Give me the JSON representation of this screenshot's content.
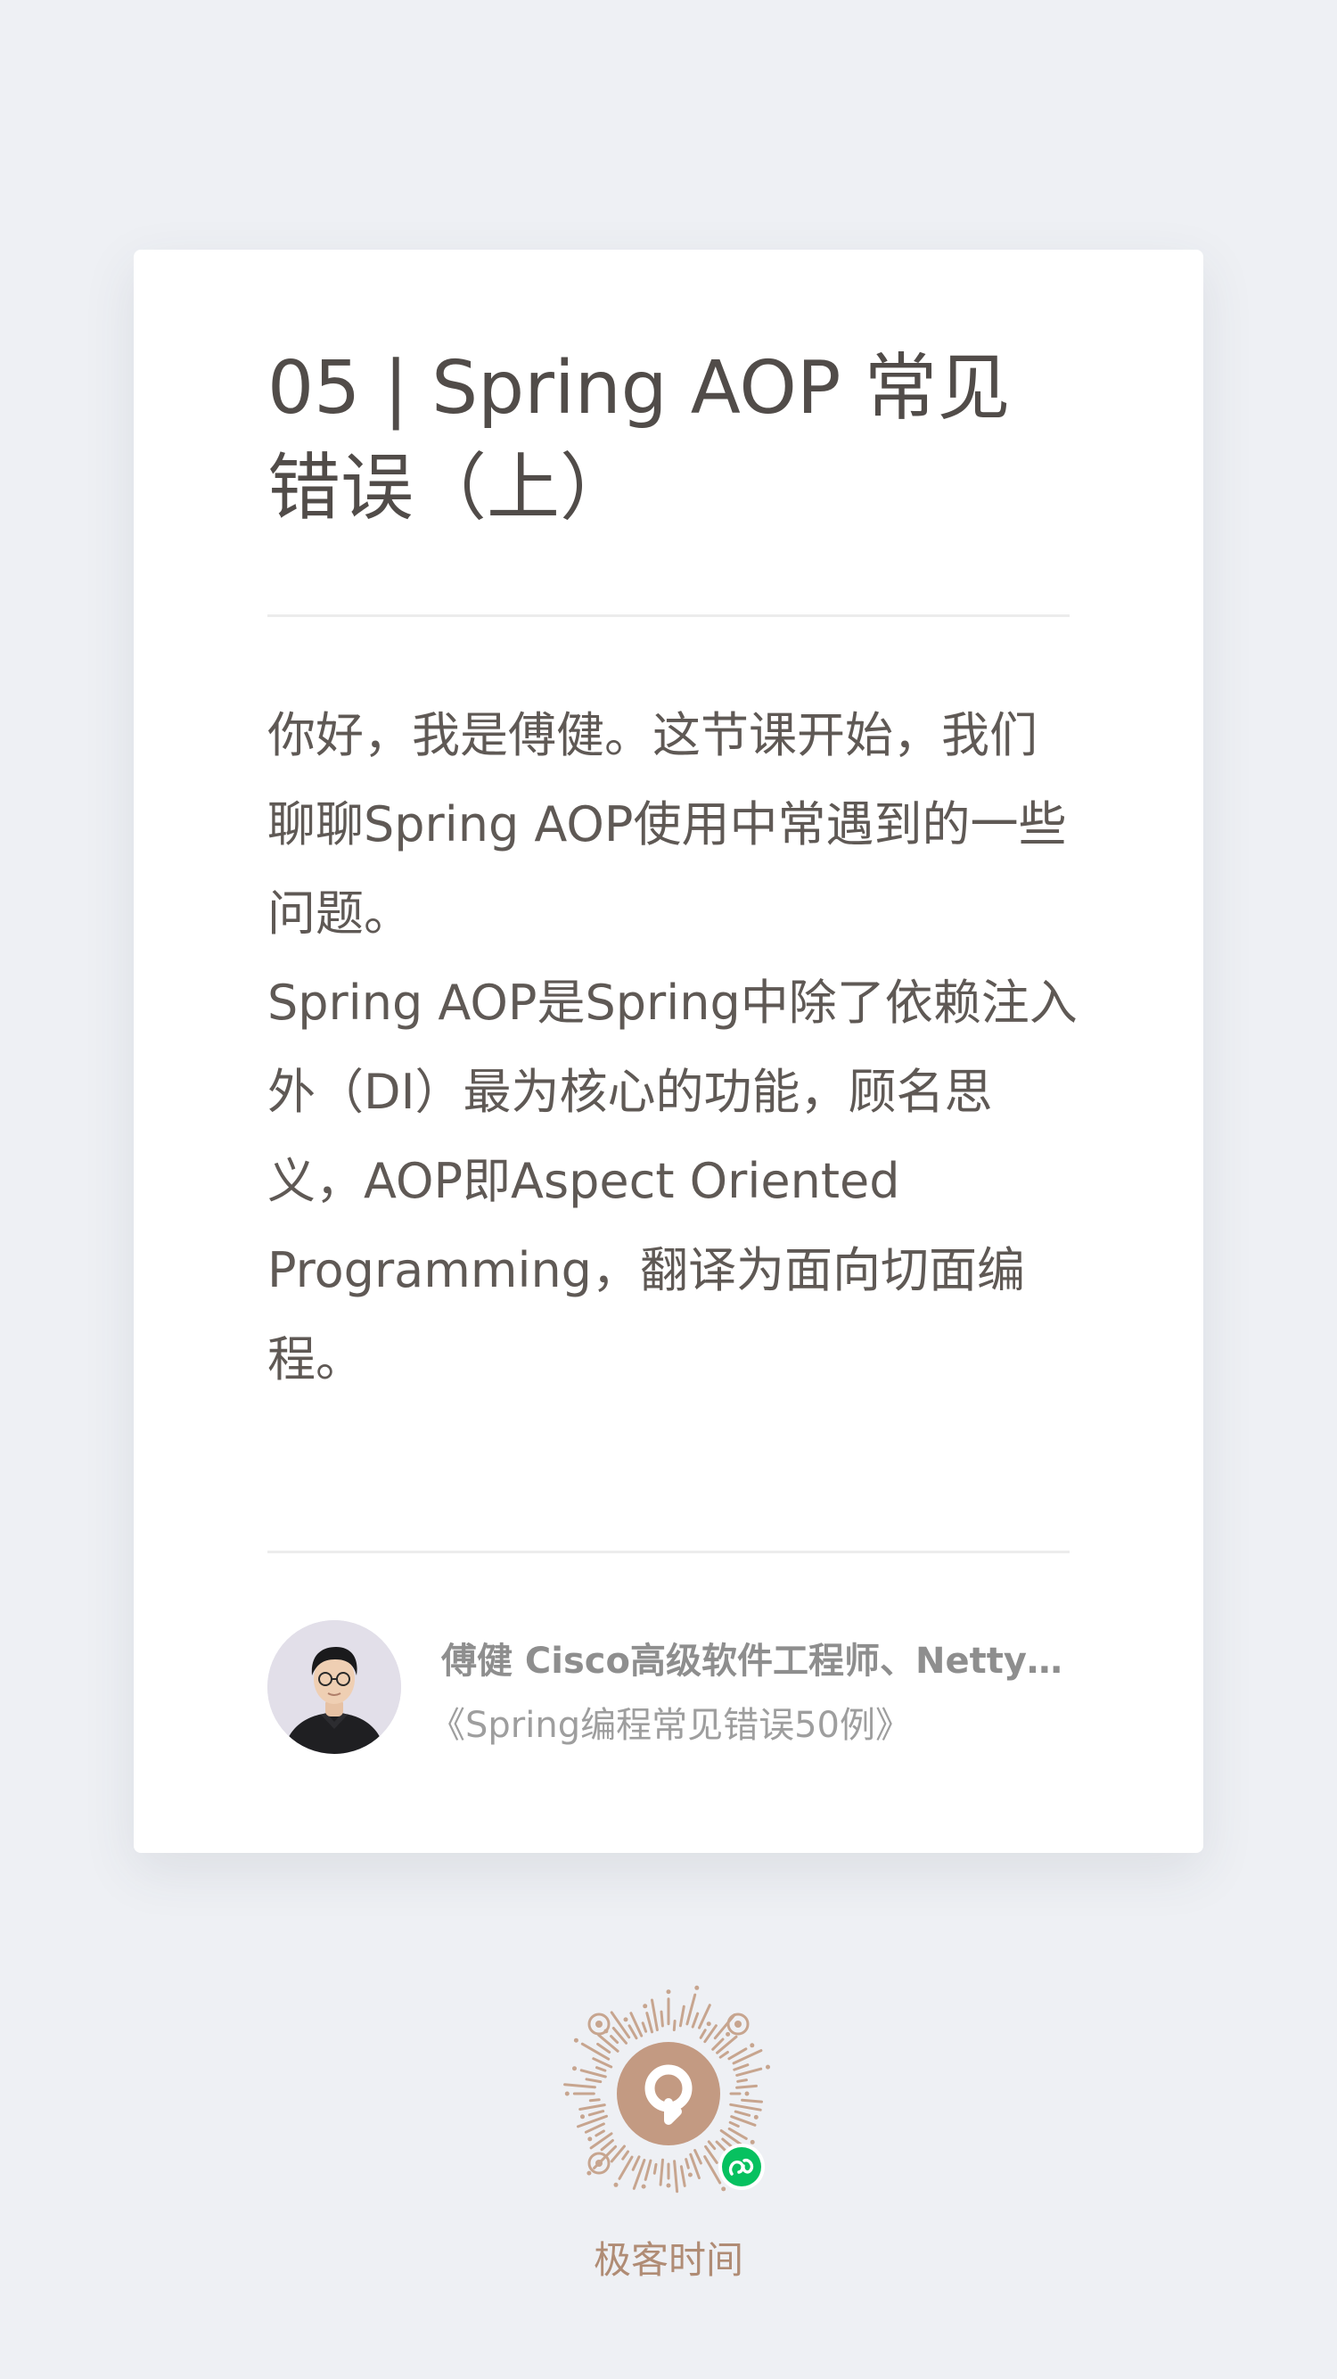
{
  "article": {
    "title": "05 | Spring AOP 常见错误（上）",
    "paragraphs": [
      "你好，我是傅健。这节课开始，我们聊聊Spring AOP使用中常遇到的一些问题。",
      "Spring AOP是Spring中除了依赖注入外（DI）最为核心的功能，顾名思义，AOP即Aspect Oriented Programming，翻译为面向切面编程。"
    ]
  },
  "author": {
    "name_line": "傅健 Cisco高级软件工程师、Netty项目贡献者",
    "course": "《Spring编程常见错误50例》"
  },
  "footer": {
    "brand": "极客时间"
  },
  "colors": {
    "page_background": "#eef0f4",
    "card_background": "#ffffff",
    "title": "#514c49",
    "body_text": "#5f5955",
    "brand_accent": "#b08c75",
    "qr_center": "#c39a82",
    "miniprogram_badge": "#07c160"
  },
  "icons": {
    "qr": "miniprogram-qr-code",
    "badge": "wechat-miniprogram-icon"
  }
}
